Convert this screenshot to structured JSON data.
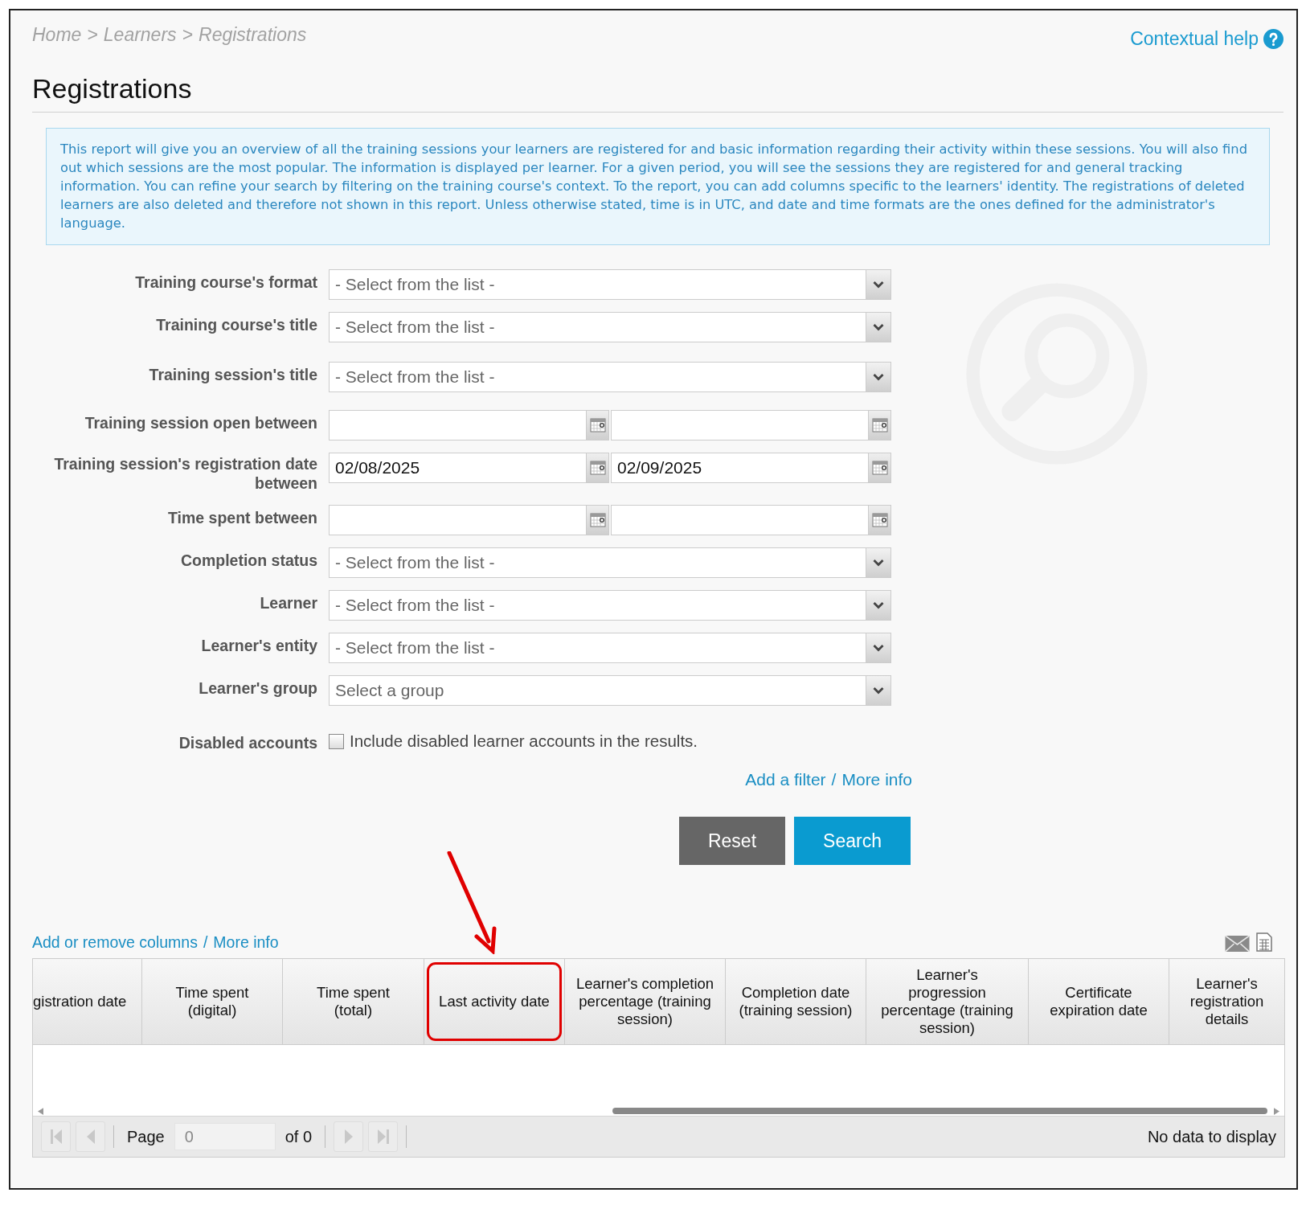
{
  "breadcrumb": {
    "separator": ">",
    "items": [
      "Home",
      "Learners",
      "Registrations"
    ]
  },
  "help_link": {
    "label": "Contextual help"
  },
  "title": "Registrations",
  "description": "This report will give you an overview of all the training sessions your learners are registered for and basic information regarding their activity within these sessions. You will also find out which sessions are the most popular. The information is displayed per learner. For a given period, you will see the sessions they are registered for and general tracking information. You can refine your search by filtering on the training course's context. To the report, you can add columns specific to the learners' identity. The registrations of deleted learners are also deleted and therefore not shown in this report. Unless otherwise stated, time is in UTC, and date and time formats are the ones defined for the administrator's language.",
  "filters": [
    {
      "kind": "select",
      "label": "Training course's format",
      "value": "- Select from the list -"
    },
    {
      "kind": "select",
      "label": "Training course's title",
      "value": "- Select from the list -"
    },
    {
      "kind": "select",
      "label": "Training session's title",
      "value": "- Select from the list -"
    },
    {
      "kind": "date_range",
      "label": "Training session open between"
    },
    {
      "kind": "date_range",
      "label": "Training session's registration date between",
      "from": "02/08/2025",
      "to": "02/09/2025"
    },
    {
      "kind": "date_range",
      "label": "Time spent between"
    },
    {
      "kind": "select",
      "label": "Completion status",
      "value": "- Select from the list -"
    },
    {
      "kind": "select",
      "label": "Learner",
      "value": "- Select from the list -"
    },
    {
      "kind": "select",
      "label": "Learner's entity",
      "value": "- Select from the list -"
    },
    {
      "kind": "select",
      "label": "Learner's group",
      "value": "Select a group"
    },
    {
      "kind": "checkbox",
      "label": "Disabled accounts",
      "text": "Include disabled learner accounts in the results.",
      "checked": false
    }
  ],
  "filter_links": {
    "separator": "/",
    "items": [
      "Add a filter",
      "More info"
    ]
  },
  "buttons": [
    {
      "kind": "secondary",
      "label": "Reset"
    },
    {
      "kind": "primary",
      "label": "Search"
    }
  ],
  "results": {
    "column_links": {
      "separator": "/",
      "items": [
        "Add or remove columns",
        "More info"
      ]
    },
    "columns": [
      {
        "label": "gistration date",
        "highlighted": false
      },
      {
        "label": "Time spent (digital)",
        "highlighted": false
      },
      {
        "label": "Time spent (total)",
        "highlighted": false
      },
      {
        "label": "Last activity date",
        "highlighted": true
      },
      {
        "label": "Learner's completion percentage (training session)",
        "highlighted": false
      },
      {
        "label": "Completion date (training session)",
        "highlighted": false
      },
      {
        "label": "Learner's progression percentage (training session)",
        "highlighted": false
      },
      {
        "label": "Certificate expiration date",
        "highlighted": false
      },
      {
        "label": "Learner's registration details",
        "highlighted": false
      }
    ],
    "pager": {
      "page_label": "Page",
      "page_value": "0",
      "of_label": "of 0",
      "status": "No data to display"
    }
  }
}
